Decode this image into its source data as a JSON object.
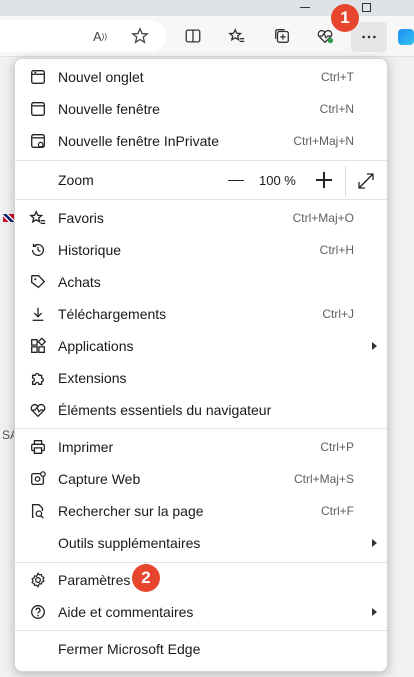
{
  "toolbar": {
    "read_aloud_icon": "read-aloud-icon",
    "favorite_icon": "star-icon",
    "icons": [
      "split-screen-icon",
      "favorites-icon",
      "collections-icon",
      "browser-essentials-icon",
      "more-icon"
    ]
  },
  "markers": {
    "one": "1",
    "two": "2"
  },
  "page": {
    "side_text": "SA"
  },
  "menu": {
    "new_tab": {
      "label": "Nouvel onglet",
      "shortcut": "Ctrl+T"
    },
    "new_window": {
      "label": "Nouvelle fenêtre",
      "shortcut": "Ctrl+N"
    },
    "inprivate": {
      "label": "Nouvelle fenêtre InPrivate",
      "shortcut": "Ctrl+Maj+N"
    },
    "zoom": {
      "label": "Zoom",
      "value": "100 %"
    },
    "favorites": {
      "label": "Favoris",
      "shortcut": "Ctrl+Maj+O"
    },
    "history": {
      "label": "Historique",
      "shortcut": "Ctrl+H"
    },
    "shopping": {
      "label": "Achats"
    },
    "downloads": {
      "label": "Téléchargements",
      "shortcut": "Ctrl+J"
    },
    "apps": {
      "label": "Applications"
    },
    "extensions": {
      "label": "Extensions"
    },
    "essentials": {
      "label": "Éléments essentiels du navigateur"
    },
    "print": {
      "label": "Imprimer",
      "shortcut": "Ctrl+P"
    },
    "web_capture": {
      "label": "Capture Web",
      "shortcut": "Ctrl+Maj+S"
    },
    "find": {
      "label": "Rechercher sur la page",
      "shortcut": "Ctrl+F"
    },
    "more_tools": {
      "label": "Outils supplémentaires"
    },
    "settings": {
      "label": "Paramètres"
    },
    "help": {
      "label": "Aide et commentaires"
    },
    "close": {
      "label": "Fermer Microsoft Edge"
    }
  },
  "colors": {
    "marker": "#e8452e",
    "menu_bg": "#ffffff",
    "toolbar_bg": "#f7f7f7"
  }
}
